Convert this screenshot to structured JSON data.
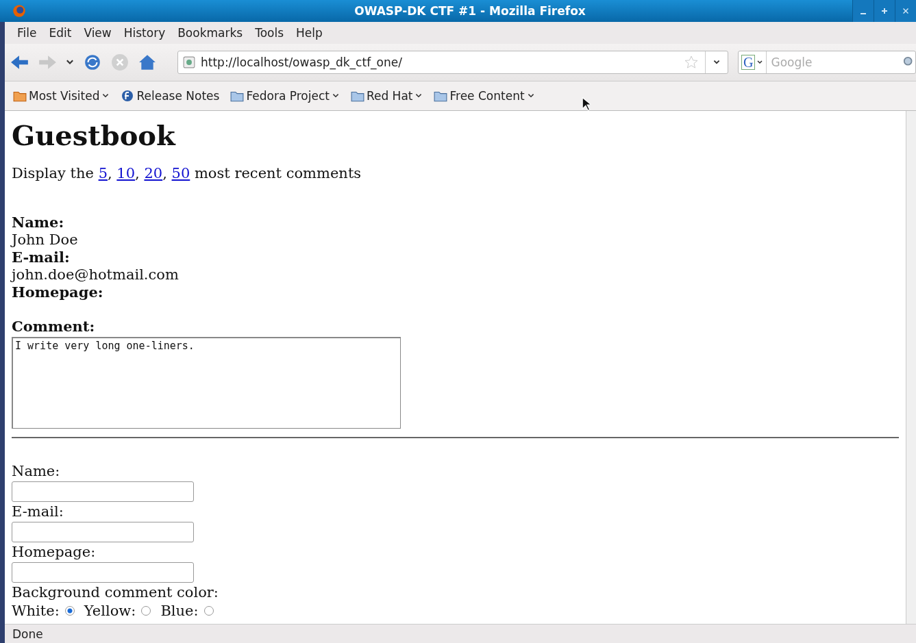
{
  "window": {
    "title": "OWASP-DK CTF #1 - Mozilla Firefox"
  },
  "menu": [
    "File",
    "Edit",
    "View",
    "History",
    "Bookmarks",
    "Tools",
    "Help"
  ],
  "navigation": {
    "url": "http://localhost/owasp_dk_ctf_one/",
    "search_engine": "G",
    "search_placeholder": "Google"
  },
  "bookmarks": [
    {
      "label": "Most Visited",
      "kind": "smart",
      "dropdown": true
    },
    {
      "label": "Release Notes",
      "kind": "fedora",
      "dropdown": false
    },
    {
      "label": "Fedora Project",
      "kind": "folder",
      "dropdown": true
    },
    {
      "label": "Red Hat",
      "kind": "folder",
      "dropdown": true
    },
    {
      "label": "Free Content",
      "kind": "folder",
      "dropdown": true
    }
  ],
  "page": {
    "heading": "Guestbook",
    "display": {
      "prefix": "Display the",
      "links": [
        "5",
        "10",
        "20",
        "50"
      ],
      "separator": ",",
      "suffix": "most recent comments"
    },
    "entry": [
      {
        "label": "Name:",
        "value": "John Doe"
      },
      {
        "label": "E-mail:",
        "value": "john.doe@hotmail.com"
      },
      {
        "label": "Homepage:"
      }
    ],
    "comment": {
      "label": "Comment:",
      "text": "I write very long one-liners."
    },
    "form": {
      "fields": [
        {
          "label": "Name:"
        },
        {
          "label": "E-mail:"
        },
        {
          "label": "Homepage:"
        }
      ],
      "color_label": "Background comment color:",
      "colors": [
        {
          "label": "White:",
          "selected": true
        },
        {
          "label": "Yellow:",
          "selected": false
        },
        {
          "label": "Blue:",
          "selected": false
        }
      ]
    }
  },
  "status_bar": "Done"
}
